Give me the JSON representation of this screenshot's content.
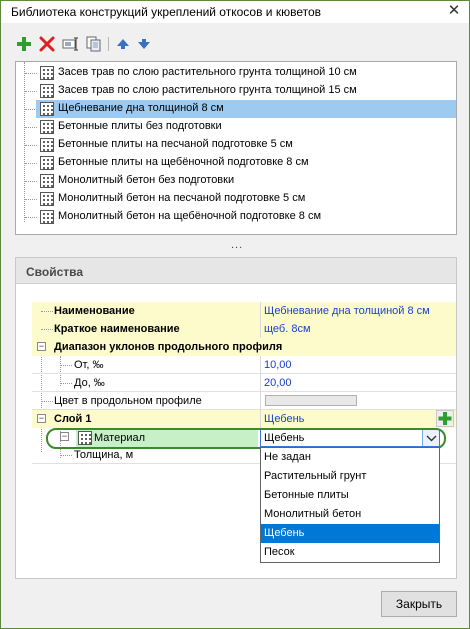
{
  "window": {
    "title": "Библиотека конструкций укреплений откосов и кюветов",
    "close_glyph": "✕"
  },
  "toolbar": {
    "add_icon": "plus-icon",
    "delete_icon": "delete-x-icon",
    "rename_icon": "rename-icon",
    "copy_icon": "copy-icon",
    "up_icon": "arrow-up-icon",
    "down_icon": "arrow-down-icon",
    "accent_add": "#2e9e2e",
    "accent_delete": "#e02020",
    "accent_arrows": "#3b6fc2"
  },
  "list": {
    "items": [
      {
        "label": "Засев трав по слою растительного грунта толщиной 10 см"
      },
      {
        "label": "Засев трав по слою растительного грунта толщиной 15 см"
      },
      {
        "label": "Щебневание дна толщиной 8 см"
      },
      {
        "label": "Бетонные плиты без подготовки"
      },
      {
        "label": "Бетонные плиты на песчаной подготовке 5 см"
      },
      {
        "label": "Бетонные плиты на щебёночной подготовке 8 см"
      },
      {
        "label": "Монолитный бетон без подготовки"
      },
      {
        "label": "Монолитный бетон на песчаной подготовке 5 см"
      },
      {
        "label": "Монолитный бетон на щебёночной подготовке 8 см"
      }
    ],
    "selected_index": 2
  },
  "splitter": "...",
  "properties": {
    "title": "Свойства",
    "rows": {
      "name": {
        "label": "Наименование",
        "value": "Щебневание дна толщиной 8 см"
      },
      "short_name": {
        "label": "Краткое наименование",
        "value": "щеб. 8см"
      },
      "slope_range": {
        "label": "Диапазон уклонов продольного профиля",
        "expander": "−"
      },
      "from": {
        "label": "От, ‰",
        "value": "10,00"
      },
      "to": {
        "label": "До, ‰",
        "value": "20,00"
      },
      "color": {
        "label": "Цвет в продольном профиле"
      },
      "layer": {
        "label": "Слой 1",
        "value": "Щебень",
        "expander": "−"
      },
      "material": {
        "label": "Материал",
        "value": "Щебень",
        "expander": "−"
      },
      "thickness": {
        "label": "Толщина, м"
      }
    },
    "plus_glyph": "+",
    "dropdown_arrow": "⌄"
  },
  "dropdown": {
    "options": [
      "Не задан",
      "Растительный грунт",
      "Бетонные плиты",
      "Монолитный бетон",
      "Щебень",
      "Песок"
    ],
    "selected_index": 4
  },
  "close_button": {
    "label": "Закрыть"
  }
}
